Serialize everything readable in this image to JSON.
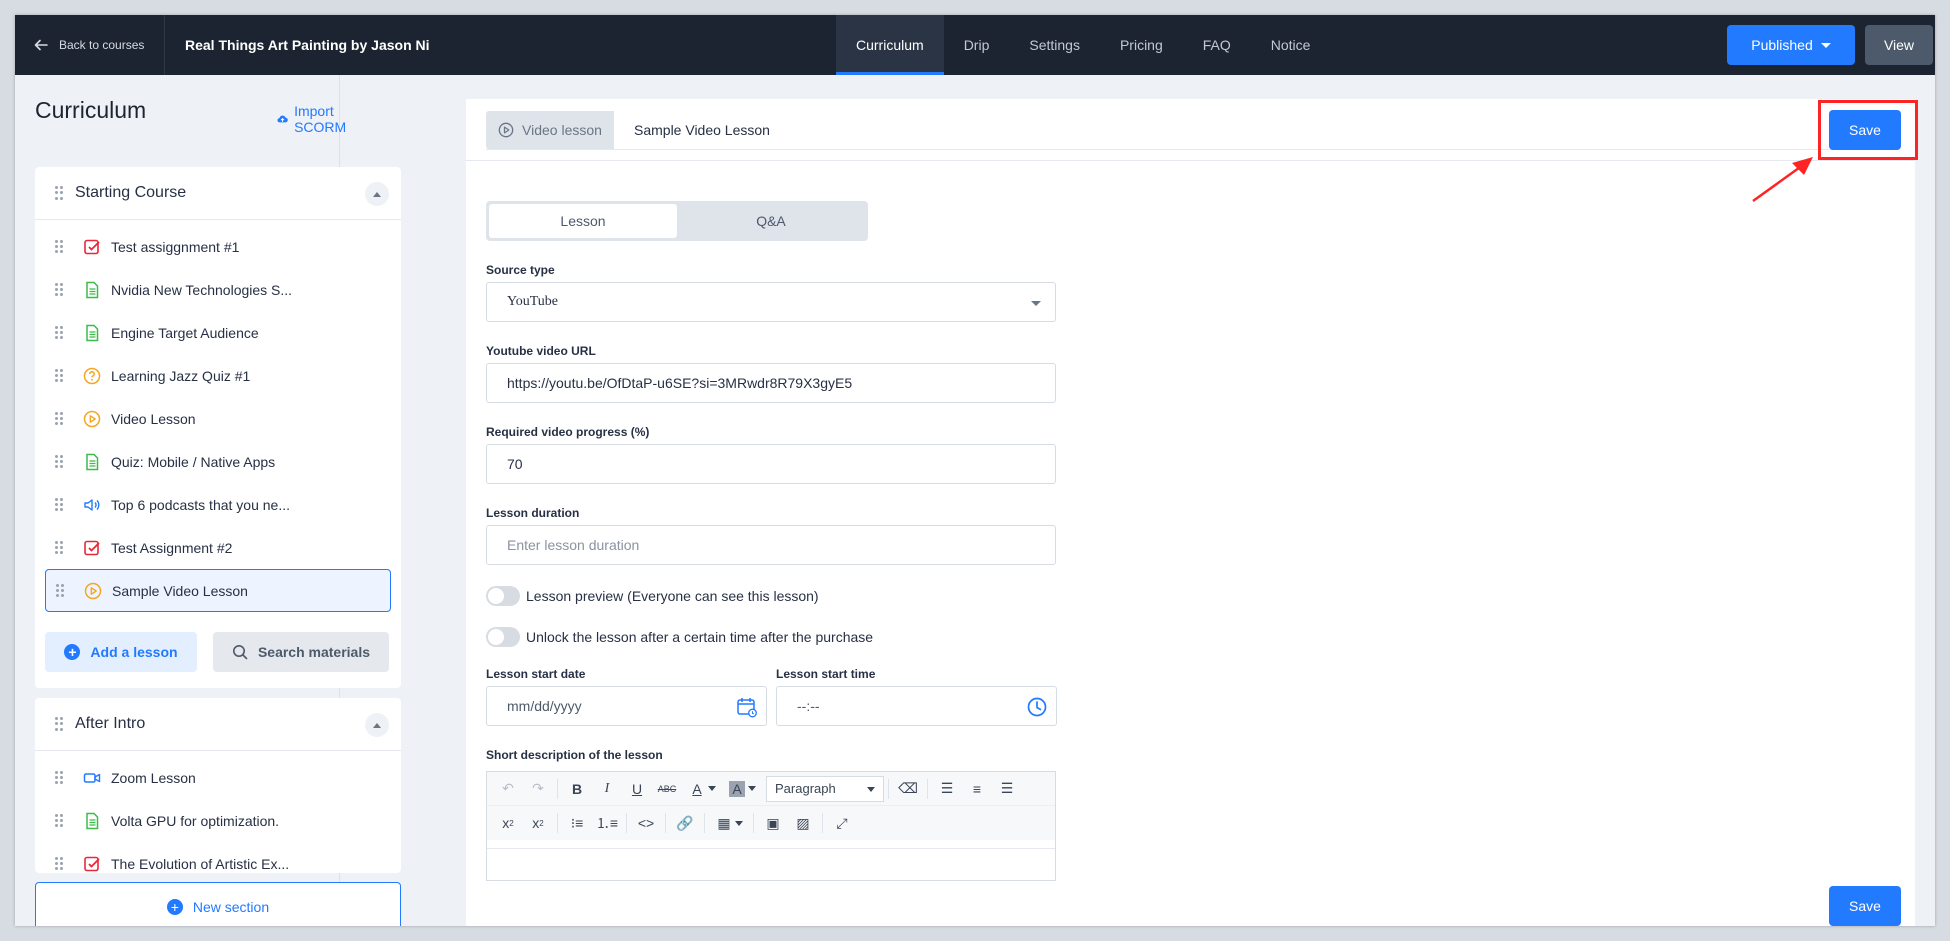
{
  "topbar": {
    "back_label": "Back to courses",
    "course_title": "Real Things Art Painting by Jason Ni",
    "tabs": [
      {
        "label": "Curriculum",
        "active": true
      },
      {
        "label": "Drip"
      },
      {
        "label": "Settings"
      },
      {
        "label": "Pricing"
      },
      {
        "label": "FAQ"
      },
      {
        "label": "Notice"
      }
    ],
    "published_label": "Published",
    "view_label": "View"
  },
  "sidebar": {
    "title": "Curriculum",
    "import_label": "Import SCORM",
    "sections": [
      {
        "name": "Starting Course",
        "lessons": [
          {
            "label": "Test assiggnment #1",
            "icon": "assignment-icon"
          },
          {
            "label": "Nvidia New Technologies S...",
            "icon": "text-lesson-icon"
          },
          {
            "label": "Engine Target Audience",
            "icon": "text-lesson-icon"
          },
          {
            "label": "Learning Jazz Quiz #1",
            "icon": "quiz-icon"
          },
          {
            "label": "Video Lesson",
            "icon": "video-lesson-icon"
          },
          {
            "label": "Quiz: Mobile / Native Apps",
            "icon": "text-lesson-icon"
          },
          {
            "label": "Top 6 podcasts that you ne...",
            "icon": "audio-lesson-icon"
          },
          {
            "label": "Test Assignment #2",
            "icon": "assignment-icon"
          },
          {
            "label": "Sample Video Lesson",
            "icon": "video-lesson-icon",
            "active": true
          }
        ],
        "add_lesson_label": "Add a lesson",
        "search_label": "Search materials"
      },
      {
        "name": "After Intro",
        "lessons": [
          {
            "label": "Zoom Lesson",
            "icon": "zoom-lesson-icon"
          },
          {
            "label": "Volta GPU for optimization.",
            "icon": "text-lesson-icon"
          },
          {
            "label": "The Evolution of Artistic Ex...",
            "icon": "assignment-icon"
          }
        ]
      }
    ],
    "new_section_label": "New section"
  },
  "main": {
    "lesson_type": "Video lesson",
    "lesson_name": "Sample Video Lesson",
    "save_label": "Save",
    "segments": [
      {
        "label": "Lesson",
        "active": true
      },
      {
        "label": "Q&A"
      }
    ],
    "source_type_label": "Source type",
    "source_type_value": "YouTube",
    "youtube_url_label": "Youtube video URL",
    "youtube_url_value": "https://youtu.be/OfDtaP-u6SE?si=3MRwdr8R79X3gyE5",
    "progress_label": "Required video progress (%)",
    "progress_value": "70",
    "duration_label": "Lesson duration",
    "duration_placeholder": "Enter lesson duration",
    "preview_toggle_label": "Lesson preview (Everyone can see this lesson)",
    "unlock_toggle_label": "Unlock the lesson after a certain time after the purchase",
    "start_date_label": "Lesson start date",
    "start_date_placeholder": "mm/dd/yyyy",
    "start_time_label": "Lesson start time",
    "start_time_placeholder": "--:--",
    "description_label": "Short description of the lesson",
    "editor_paragraph_label": "Paragraph"
  },
  "colors": {
    "accent": "#227aff",
    "topbar": "#1c2431",
    "highlight": "#ff2424"
  }
}
